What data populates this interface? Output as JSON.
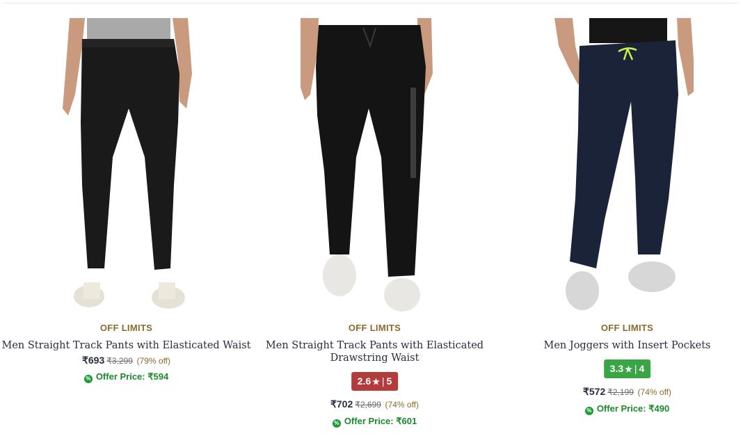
{
  "products": [
    {
      "brand": "OFF LIMITS",
      "title_line1": "Men Straight Track Pants with Elasticated Waist",
      "title_line2": "",
      "rating": null,
      "price": "₹693",
      "mrp": "₹3,299",
      "discount": "(79% off)",
      "offer_price": "Offer Price: ₹594",
      "pants_color": "#1a1a1a",
      "shirt_color": "#a9a9a9"
    },
    {
      "brand": "OFF LIMITS",
      "title_line1": "Men Straight Track Pants with Elasticated",
      "title_line2": "Drawstring Waist",
      "rating": {
        "score": "2.6",
        "star": "★",
        "sep": "|",
        "count": "5",
        "bg": "#b23b3b"
      },
      "price": "₹702",
      "mrp": "₹2,699",
      "discount": "(74% off)",
      "offer_price": "Offer Price: ₹601",
      "pants_color": "#141414",
      "shirt_color": "#ffffff"
    },
    {
      "brand": "OFF LIMITS",
      "title_line1": "Men Joggers with Insert Pockets",
      "title_line2": "",
      "rating": {
        "score": "3.3",
        "star": "★",
        "sep": "|",
        "count": "4",
        "bg": "#3aa544"
      },
      "price": "₹572",
      "mrp": "₹2,199",
      "discount": "(74% off)",
      "offer_price": "Offer Price: ₹490",
      "pants_color": "#1b2338",
      "shirt_color": "#161616"
    }
  ],
  "offer_icon": "percent-badge-icon"
}
